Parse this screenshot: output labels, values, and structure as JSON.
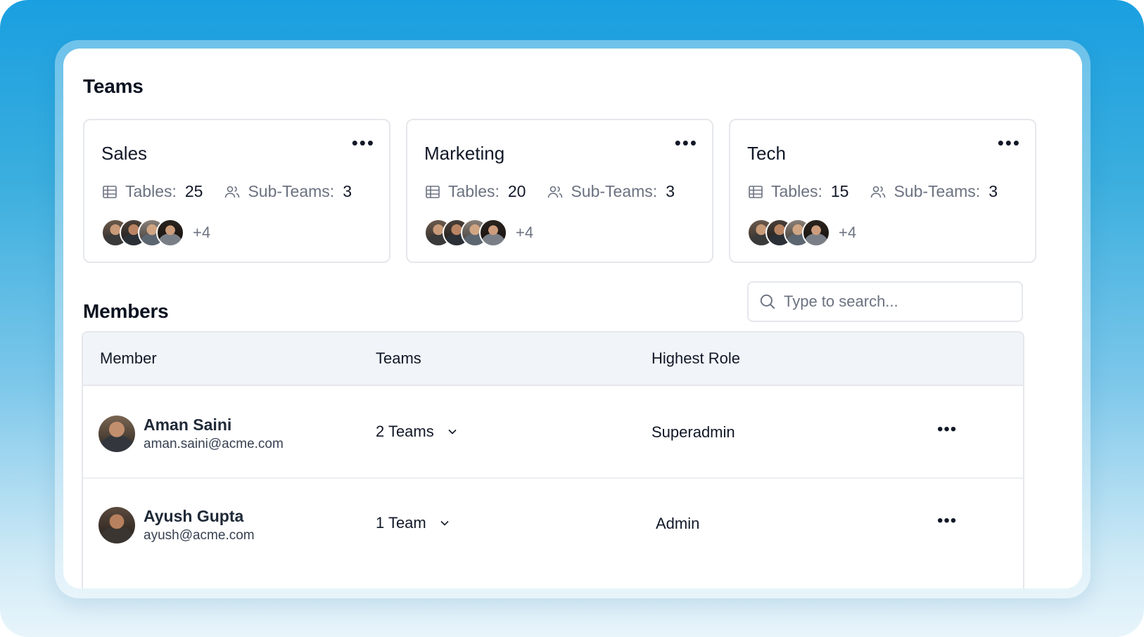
{
  "teams_section": {
    "title": "Teams",
    "cards": [
      {
        "name": "Sales",
        "tables_label": "Tables:",
        "tables": "25",
        "subteams_label": "Sub-Teams:",
        "subteams": "3",
        "more_members": "+4",
        "menu": "•••"
      },
      {
        "name": "Marketing",
        "tables_label": "Tables:",
        "tables": "20",
        "subteams_label": "Sub-Teams:",
        "subteams": "3",
        "more_members": "+4",
        "menu": "•••"
      },
      {
        "name": "Tech",
        "tables_label": "Tables:",
        "tables": "15",
        "subteams_label": "Sub-Teams:",
        "subteams": "3",
        "more_members": "+4",
        "menu": "•••"
      }
    ]
  },
  "members_section": {
    "title": "Members",
    "search": {
      "placeholder": "Type to search..."
    },
    "columns": [
      "Member",
      "Teams",
      "Highest Role"
    ],
    "rows": [
      {
        "name": "Aman Saini",
        "email": "aman.saini@acme.com",
        "teams": "2 Teams",
        "role": "Superadmin",
        "menu": "•••"
      },
      {
        "name": "Ayush Gupta",
        "email": "ayush@acme.com",
        "teams": "1 Team",
        "role": "Admin",
        "menu": "•••"
      }
    ]
  },
  "icons": {
    "table": "table-grid-icon",
    "subteams": "users-icon",
    "search": "search-icon",
    "chevron": "chevron-down-icon",
    "menu": "more-horizontal-icon"
  },
  "colors": {
    "background_top": "#1a9fe0",
    "background_bottom": "#e8f5fb",
    "panel": "#ffffff",
    "border": "#e5e7eb",
    "table_header": "#f1f4f8",
    "muted_text": "#6b7280"
  }
}
